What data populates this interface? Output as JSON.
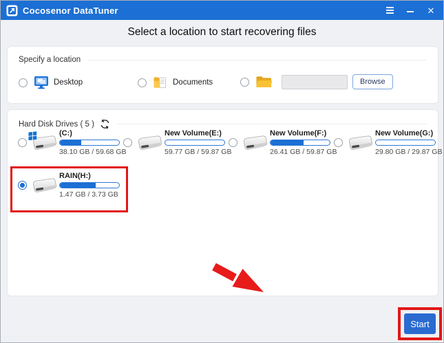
{
  "window": {
    "title": "Cocosenor DataTuner",
    "close_icon": "✕"
  },
  "heading": "Select a location to start recovering files",
  "specify_section": {
    "label": "Specify a location",
    "desktop": {
      "label": "Desktop",
      "selected": false
    },
    "documents": {
      "label": "Documents",
      "selected": false
    },
    "custom": {
      "input_value": "",
      "browse_label": "Browse",
      "selected": false
    }
  },
  "drives_section": {
    "label": "Hard Disk Drives ( 5 )",
    "count": 5,
    "drives": [
      {
        "name": "(C:)",
        "size_text": "38.10 GB / 59.68 GB",
        "used_percent": 36,
        "selected": false,
        "os_drive": true
      },
      {
        "name": "New Volume(E:)",
        "size_text": "59.77 GB / 59.87 GB",
        "used_percent": 0,
        "selected": false,
        "os_drive": false
      },
      {
        "name": "New Volume(F:)",
        "size_text": "26.41 GB / 59.87 GB",
        "used_percent": 56,
        "selected": false,
        "os_drive": false
      },
      {
        "name": "New Volume(G:)",
        "size_text": "29.80 GB / 29.87 GB",
        "used_percent": 0,
        "selected": false,
        "os_drive": false
      },
      {
        "name": "RAIN(H:)",
        "size_text": "1.47 GB / 3.73 GB",
        "used_percent": 61,
        "selected": true,
        "os_drive": false
      }
    ]
  },
  "footer": {
    "start_label": "Start"
  },
  "colors": {
    "titlebar": "#1c6fd4",
    "accent": "#1c6fd4",
    "annotation_red": "#e31717",
    "start_button": "#2b6bd0"
  }
}
